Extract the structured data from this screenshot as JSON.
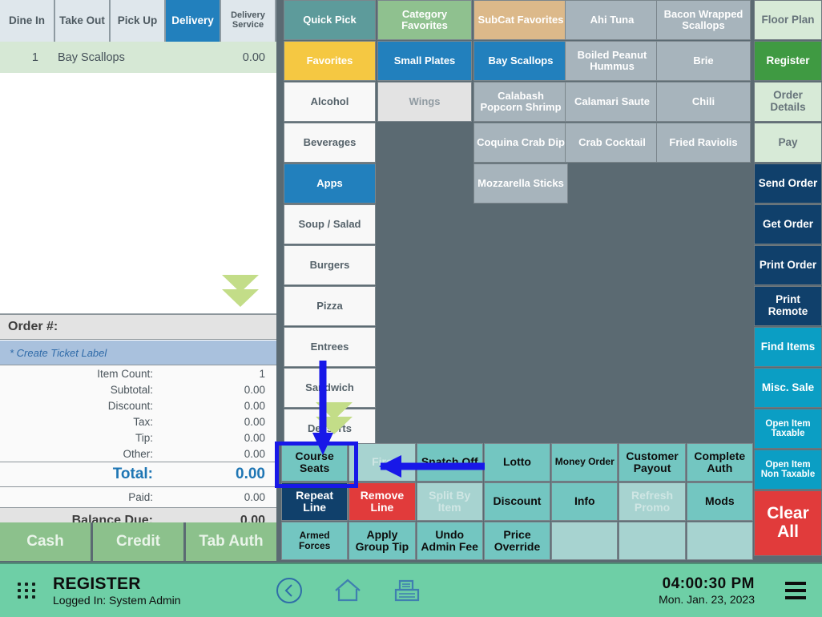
{
  "order_panel": {
    "order_type_tabs": [
      {
        "label": "Dine In",
        "active": false
      },
      {
        "label": "Take Out",
        "active": false
      },
      {
        "label": "Pick Up",
        "active": false
      },
      {
        "label": "Delivery",
        "active": true
      },
      {
        "label": "Delivery Service",
        "active": false
      }
    ],
    "lines": [
      {
        "qty": "1",
        "name": "Bay Scallops",
        "price": "0.00"
      }
    ],
    "order_number_label": "Order #:",
    "ticket_label": "* Create Ticket Label",
    "totals": [
      {
        "label": "Item Count:",
        "value": "1"
      },
      {
        "label": "Subtotal:",
        "value": "0.00"
      },
      {
        "label": "Discount:",
        "value": "0.00"
      },
      {
        "label": "Tax:",
        "value": "0.00"
      },
      {
        "label": "Tip:",
        "value": "0.00"
      },
      {
        "label": "Other:",
        "value": "0.00"
      }
    ],
    "total": {
      "label": "Total:",
      "value": "0.00"
    },
    "paid": {
      "label": "Paid:",
      "value": "0.00"
    },
    "balance_due": {
      "label": "Balance Due:",
      "value": "0.00"
    },
    "pay_buttons": [
      "Cash",
      "Credit",
      "Tab Auth"
    ],
    "scroll_down_icon": "double-chevron-down-icon"
  },
  "categories": [
    {
      "label": "Quick Pick",
      "style": "teal"
    },
    {
      "label": "Favorites",
      "style": "gold"
    },
    {
      "label": "Alcohol",
      "style": "white"
    },
    {
      "label": "Beverages",
      "style": "white"
    },
    {
      "label": "Apps",
      "style": "blue"
    },
    {
      "label": "Soup / Salad",
      "style": "white"
    },
    {
      "label": "Burgers",
      "style": "white"
    },
    {
      "label": "Pizza",
      "style": "white"
    },
    {
      "label": "Entrees",
      "style": "white"
    },
    {
      "label": "Sandwich",
      "style": "white"
    },
    {
      "label": "Desserts",
      "style": "white"
    }
  ],
  "subcategories": [
    {
      "label": "Category Favorites",
      "style": "green"
    },
    {
      "label": "Small Plates",
      "style": "blue"
    },
    {
      "label": "Wings",
      "style": "grey"
    }
  ],
  "items_col1": [
    {
      "label": "SubCat Favorites",
      "style": "tan"
    },
    {
      "label": "Bay Scallops",
      "style": "blue"
    },
    {
      "label": "Calabash Popcorn Shrimp",
      "style": "slate"
    },
    {
      "label": "Coquina Crab Dip",
      "style": "slate"
    },
    {
      "label": "Mozzarella Sticks",
      "style": "slate"
    }
  ],
  "items_col2": [
    {
      "label": "Ahi Tuna",
      "style": "slate"
    },
    {
      "label": "Boiled Peanut Hummus",
      "style": "slate"
    },
    {
      "label": "Calamari Saute",
      "style": "slate"
    },
    {
      "label": "Crab Cocktail",
      "style": "slate"
    }
  ],
  "items_col3": [
    {
      "label": "Bacon Wrapped Scallops",
      "style": "slate"
    },
    {
      "label": "Brie",
      "style": "slate"
    },
    {
      "label": "Chili",
      "style": "slate"
    },
    {
      "label": "Fried Raviolis",
      "style": "slate"
    }
  ],
  "function_rows": [
    [
      {
        "label": "Course Seats",
        "style": "teal",
        "highlighted": true
      },
      {
        "label": "Fire",
        "style": "disabled"
      },
      {
        "label": "Snatch Off",
        "style": "teal"
      },
      {
        "label": "Lotto",
        "style": "teal"
      },
      {
        "label": "Money Order",
        "style": "teal",
        "small": true
      },
      {
        "label": "Customer Payout",
        "style": "teal"
      },
      {
        "label": "Complete Auth",
        "style": "teal"
      }
    ],
    [
      {
        "label": "Repeat Line",
        "style": "navy"
      },
      {
        "label": "Remove Line",
        "style": "red"
      },
      {
        "label": "Split By Item",
        "style": "disabled"
      },
      {
        "label": "Discount",
        "style": "teal"
      },
      {
        "label": "Info",
        "style": "teal"
      },
      {
        "label": "Refresh Promo",
        "style": "disabled"
      },
      {
        "label": "Mods",
        "style": "teal"
      }
    ],
    [
      {
        "label": "Armed Forces",
        "style": "teal",
        "small": true
      },
      {
        "label": "Apply Group Tip",
        "style": "teal"
      },
      {
        "label": "Undo Admin Fee",
        "style": "teal"
      },
      {
        "label": "Price Override",
        "style": "teal"
      },
      {
        "label": "",
        "style": "empty"
      },
      {
        "label": "",
        "style": "empty"
      },
      {
        "label": "",
        "style": "empty"
      }
    ]
  ],
  "right_sidebar": [
    {
      "label": "Floor Plan",
      "style": "mint"
    },
    {
      "label": "Register",
      "style": "green"
    },
    {
      "label": "Order Details",
      "style": "mint"
    },
    {
      "label": "Pay",
      "style": "mint"
    },
    {
      "label": "Send Order",
      "style": "navy"
    },
    {
      "label": "Get Order",
      "style": "navy"
    },
    {
      "label": "Print Order",
      "style": "navy"
    },
    {
      "label": "Print Remote",
      "style": "navy"
    },
    {
      "label": "Find Items",
      "style": "cyan"
    },
    {
      "label": "Misc. Sale",
      "style": "cyan"
    },
    {
      "label": "Open Item Taxable",
      "style": "cyan",
      "small": true
    },
    {
      "label": "Open Item Non Taxable",
      "style": "cyan",
      "small": true
    },
    {
      "label": "Clear All",
      "style": "red"
    }
  ],
  "status_bar": {
    "app_grid_icon": "app-grid-icon",
    "title": "REGISTER",
    "logged_in": "Logged In:  System Admin",
    "nav_icons": [
      "back-circle-icon",
      "home-icon",
      "cash-register-icon"
    ],
    "time": "04:00:30 PM",
    "date": "Mon. Jan. 23, 2023",
    "lock_icon": "lock-icon",
    "menu_icon": "hamburger-menu-icon"
  },
  "annotations": {
    "highlight_color": "#1818E8",
    "highlight_target": "Course Seats",
    "arrow_left_icon": "arrow-left-annotation",
    "arrow_down_icon": "arrow-down-annotation"
  }
}
